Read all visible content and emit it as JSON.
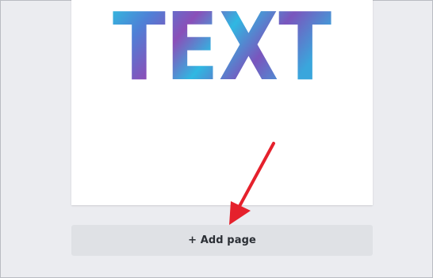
{
  "canvas": {
    "design_text": "TEXT"
  },
  "add_page_button": {
    "label": "+ Add page"
  },
  "colors": {
    "workspace_background": "#ebecf0",
    "page_background": "#ffffff",
    "button_background": "#dfe1e5",
    "button_text": "#2b2f35",
    "arrow": "#e5212c",
    "gradient_stops": [
      "#2bc8e0",
      "#4f7fd6",
      "#8a4fb8",
      "#3aa6dc"
    ]
  }
}
